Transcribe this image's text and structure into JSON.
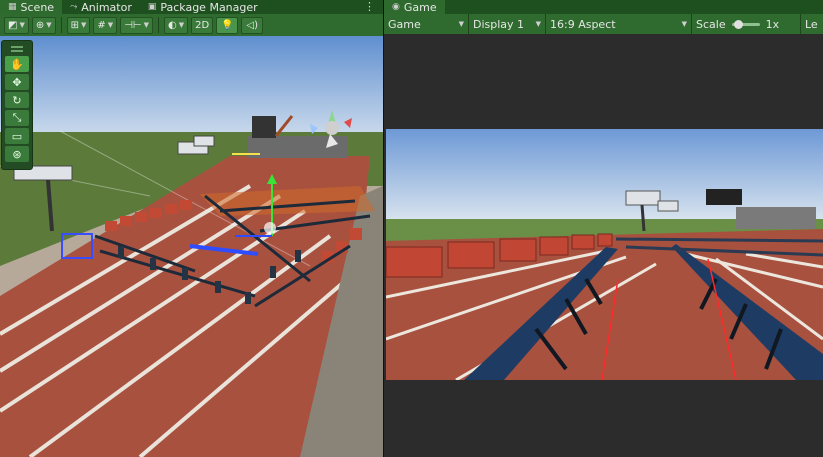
{
  "scene_panel": {
    "tabs": [
      {
        "label": "Scene",
        "icon": "grid-icon"
      },
      {
        "label": "Animator",
        "icon": "animator-icon"
      },
      {
        "label": "Package Manager",
        "icon": "package-icon"
      }
    ],
    "more_menu": "⋮",
    "toolbar": {
      "view_2d_label": "2D",
      "buttons": [
        "draw-mode",
        "orientation",
        "snap",
        "grid",
        "increment",
        "rendering",
        "view-2d",
        "lighting"
      ]
    },
    "tools": [
      "hand-tool",
      "move-tool",
      "rotate-tool",
      "scale-tool",
      "rect-tool",
      "transform-tool"
    ]
  },
  "game_panel": {
    "tab_label": "Game",
    "toolbar": {
      "mode": "Game",
      "display": "Display 1",
      "aspect": "16:9 Aspect",
      "scale_label": "Scale",
      "scale_value": "1x",
      "overflow_label": "Le"
    }
  },
  "colors": {
    "accent_green": "#2f6a2f",
    "tab_green": "#1e4f1f",
    "track": "#a8513f",
    "lane_line": "#e7e3dc",
    "sky_top": "#6a98d6",
    "grass": "#5a7a3a"
  }
}
